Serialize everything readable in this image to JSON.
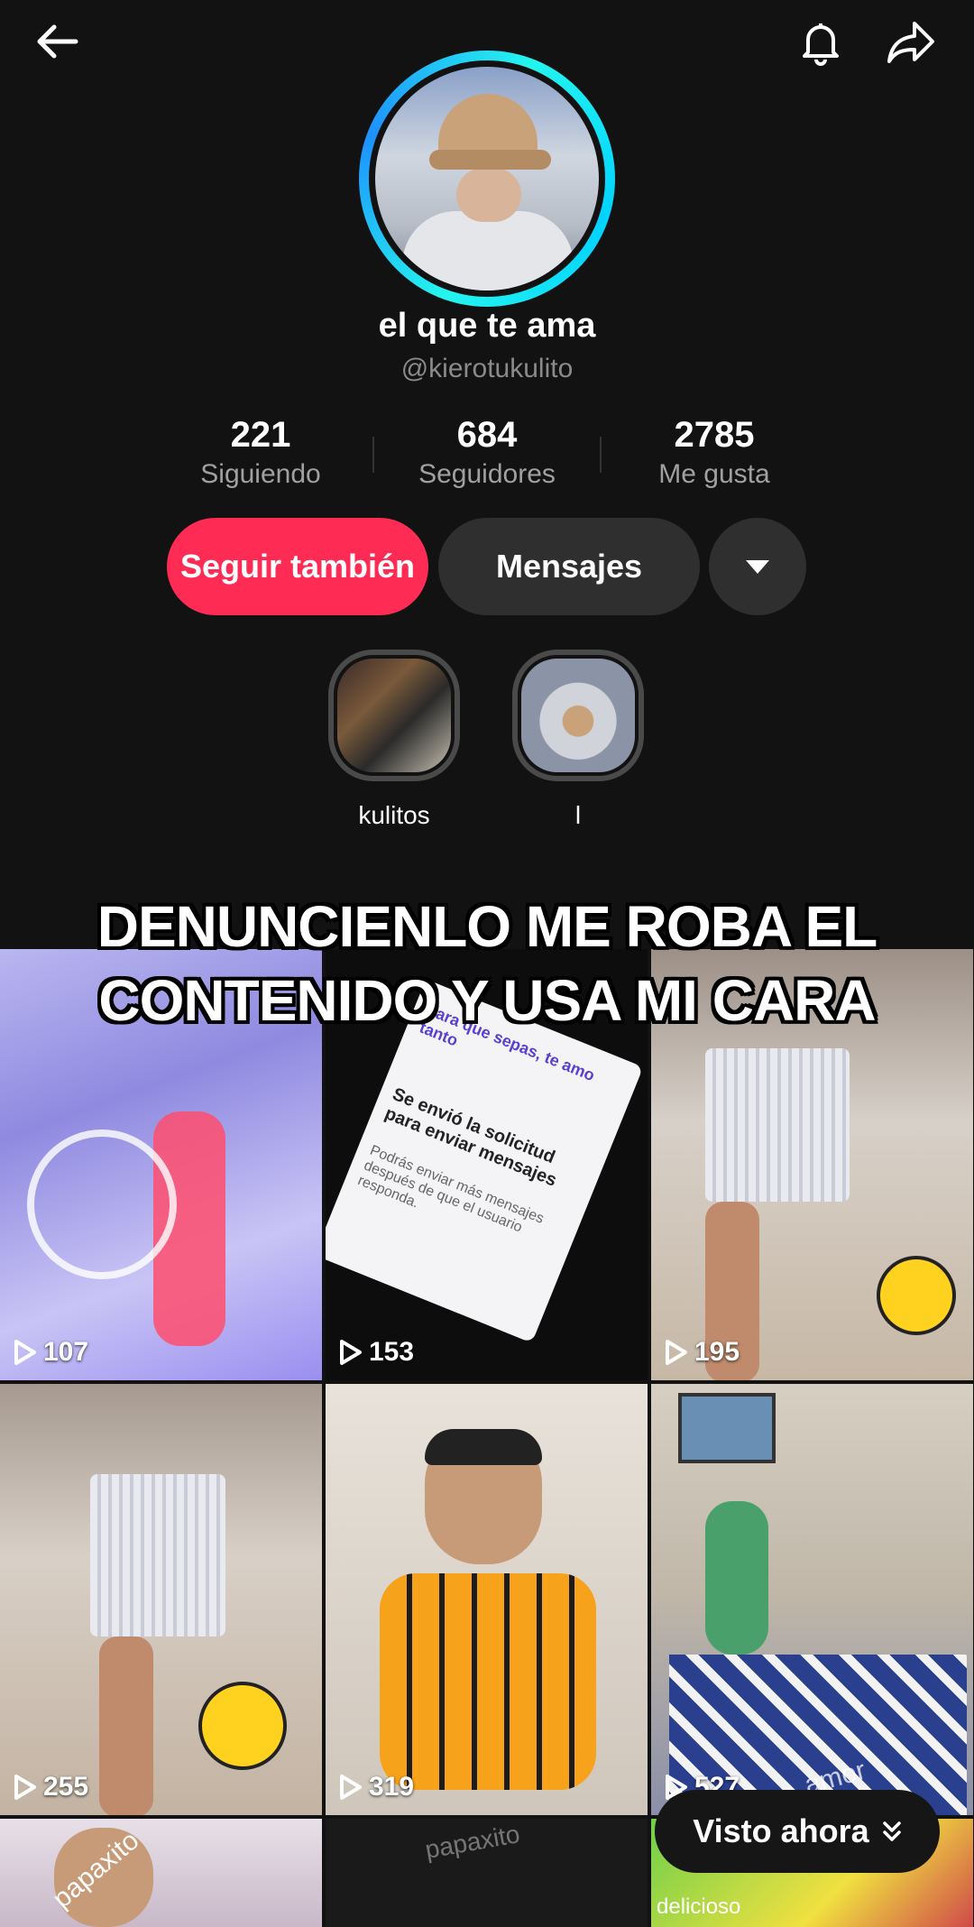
{
  "header": {
    "back_icon": "arrow-left-icon",
    "bell_icon": "bell-icon",
    "share_icon": "share-arrow-icon"
  },
  "profile": {
    "display_name": "el que te ama",
    "username": "@kierotukulito",
    "stats": [
      {
        "value": "221",
        "label": "Siguiendo"
      },
      {
        "value": "684",
        "label": "Seguidores"
      },
      {
        "value": "2785",
        "label": "Me gusta"
      }
    ]
  },
  "actions": {
    "follow_label": "Seguir también",
    "message_label": "Mensajes",
    "more_icon": "caret-down-icon"
  },
  "highlights": [
    {
      "label": "kulitos"
    },
    {
      "label": "l"
    }
  ],
  "overlay": {
    "line1": "DENUNCIENLO ME ROBA EL",
    "line2": "CONTENIDO Y USA MI CARA"
  },
  "grid": {
    "play_icon": "play-outline-icon",
    "tiles": [
      {
        "views": "107"
      },
      {
        "views": "153"
      },
      {
        "views": "195"
      },
      {
        "views": "255"
      },
      {
        "views": "319"
      },
      {
        "views": "527"
      },
      {
        "views": ""
      },
      {
        "views": ""
      },
      {
        "views": ""
      }
    ]
  },
  "tile_texts": {
    "tile2_a": "Se envió la solicitud para enviar mensajes",
    "tile2_b": "Podrás enviar más mensajes después de que el usuario responda.",
    "tile2_c": "para que sepas, te amo tanto",
    "tile6": "amor",
    "tile7": "papaxito",
    "tile8": "papaxito",
    "tile9": "delicioso"
  },
  "floating": {
    "watched_label": "Visto ahora",
    "chevron_icon": "double-chevron-down-icon"
  },
  "colors": {
    "accent": "#fe2c55",
    "ring": "#25f4ee",
    "background": "#121212"
  }
}
